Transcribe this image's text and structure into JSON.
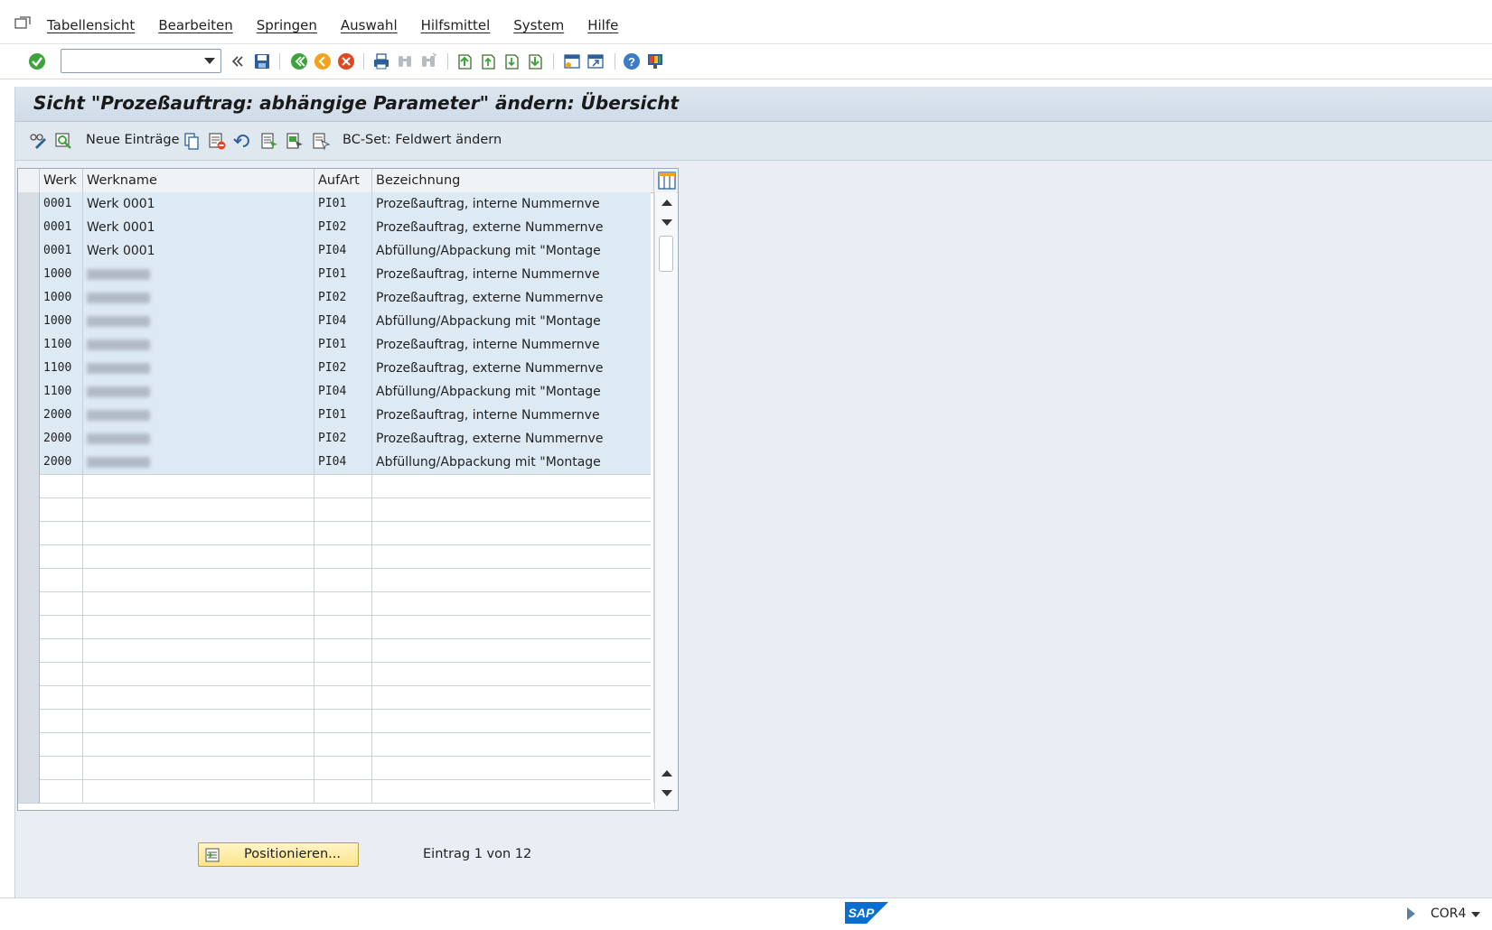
{
  "menu": {
    "items": [
      "Tabellensicht",
      "Bearbeiten",
      "Springen",
      "Auswahl",
      "Hilfsmittel",
      "System",
      "Hilfe"
    ]
  },
  "toolbar": {
    "command_field_value": "",
    "icons": [
      "enter-check-icon",
      "save-icon",
      "back-icon",
      "exit-icon",
      "cancel-icon",
      "print-icon",
      "find-icon",
      "find-next-icon",
      "first-page-icon",
      "previous-page-icon",
      "next-page-icon",
      "last-page-icon",
      "create-session-icon",
      "shortcut-icon",
      "help-icon",
      "customize-layout-icon"
    ]
  },
  "title": "Sicht \"Prozeßauftrag: abhängige Parameter\" ändern: Übersicht",
  "app_toolbar": {
    "new_entries": "Neue Einträge",
    "bcset": "BC-Set: Feldwert ändern"
  },
  "table": {
    "headers": {
      "werk": "Werk",
      "werkname": "Werkname",
      "aufart": "AufArt",
      "bezeichnung": "Bezeichnung"
    },
    "rows": [
      {
        "werk": "0001",
        "werkname": "Werk 0001",
        "aufart": "PI01",
        "bezeichnung": "Prozeßauftrag, interne Nummernve",
        "name_blurred": false
      },
      {
        "werk": "0001",
        "werkname": "Werk 0001",
        "aufart": "PI02",
        "bezeichnung": "Prozeßauftrag, externe Nummernve",
        "name_blurred": false
      },
      {
        "werk": "0001",
        "werkname": "Werk 0001",
        "aufart": "PI04",
        "bezeichnung": "Abfüllung/Abpackung mit \"Montage",
        "name_blurred": false
      },
      {
        "werk": "1000",
        "werkname": "",
        "aufart": "PI01",
        "bezeichnung": "Prozeßauftrag, interne Nummernve",
        "name_blurred": true
      },
      {
        "werk": "1000",
        "werkname": "",
        "aufart": "PI02",
        "bezeichnung": "Prozeßauftrag, externe Nummernve",
        "name_blurred": true
      },
      {
        "werk": "1000",
        "werkname": "",
        "aufart": "PI04",
        "bezeichnung": "Abfüllung/Abpackung mit \"Montage",
        "name_blurred": true
      },
      {
        "werk": "1100",
        "werkname": "",
        "aufart": "PI01",
        "bezeichnung": "Prozeßauftrag, interne Nummernve",
        "name_blurred": true
      },
      {
        "werk": "1100",
        "werkname": "",
        "aufart": "PI02",
        "bezeichnung": "Prozeßauftrag, externe Nummernve",
        "name_blurred": true
      },
      {
        "werk": "1100",
        "werkname": "",
        "aufart": "PI04",
        "bezeichnung": "Abfüllung/Abpackung mit \"Montage",
        "name_blurred": true
      },
      {
        "werk": "2000",
        "werkname": "",
        "aufart": "PI01",
        "bezeichnung": "Prozeßauftrag, interne Nummernve",
        "name_blurred": true
      },
      {
        "werk": "2000",
        "werkname": "",
        "aufart": "PI02",
        "bezeichnung": "Prozeßauftrag, externe Nummernve",
        "name_blurred": true
      },
      {
        "werk": "2000",
        "werkname": "",
        "aufart": "PI04",
        "bezeichnung": "Abfüllung/Abpackung mit \"Montage",
        "name_blurred": true
      }
    ],
    "empty_rows": 14
  },
  "footer": {
    "position_button": "Positionieren...",
    "entry_info": "Eintrag 1 von 12"
  },
  "status": {
    "logo": "SAP",
    "system": "COR4"
  },
  "colors": {
    "accent_blue": "#0a6ed1",
    "title_bg": "#d6e1ec",
    "row_fill": "#dde9f3",
    "button_yellow": "#fde58a"
  }
}
